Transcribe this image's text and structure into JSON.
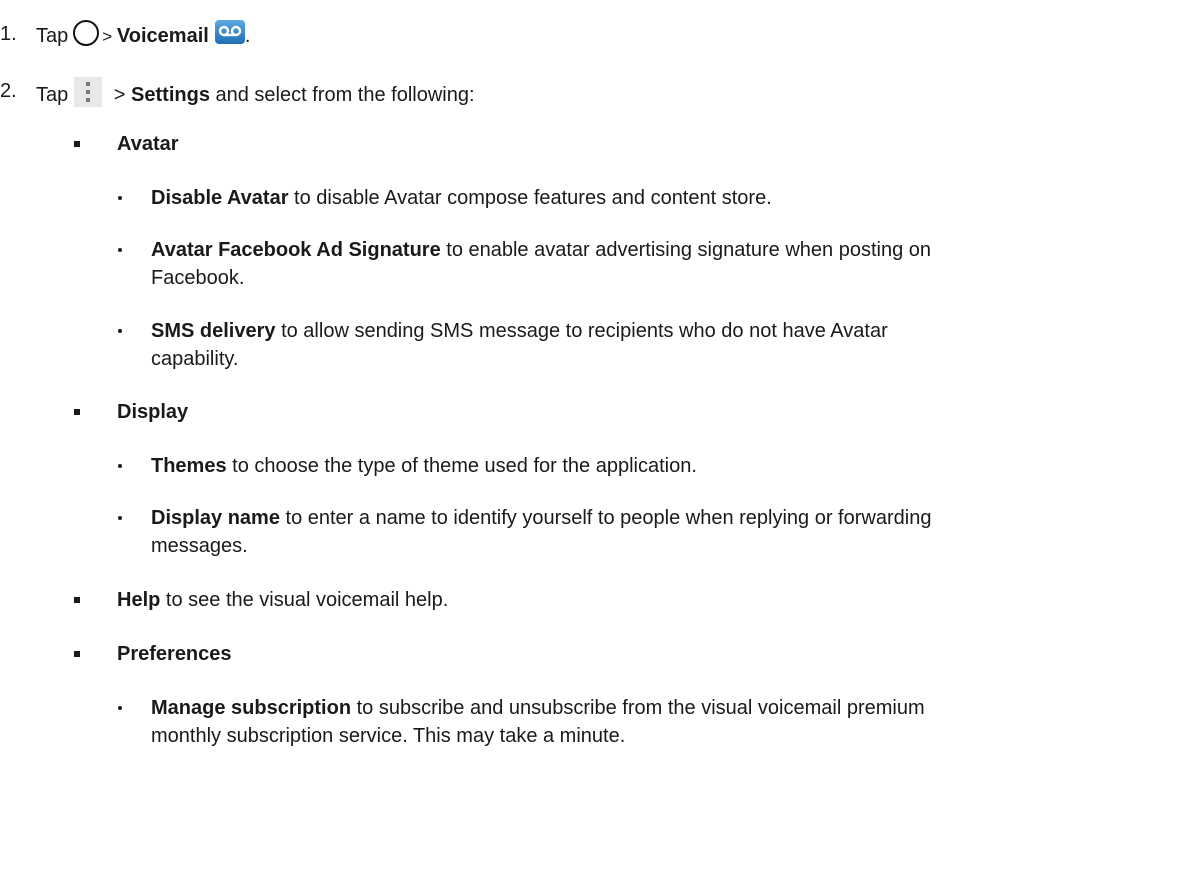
{
  "steps": [
    {
      "number": "1.",
      "pre": "Tap",
      "mid": "> ",
      "bold": "Voicemail",
      "post": "."
    },
    {
      "number": "2.",
      "pre": "Tap",
      "mid": " > ",
      "bold": "Settings",
      "post": " and select from the following:"
    }
  ],
  "sections": {
    "avatar": {
      "heading": "Avatar",
      "items": [
        {
          "bold": "Disable Avatar",
          "text": " to disable Avatar compose features and content store."
        },
        {
          "bold": "Avatar Facebook Ad Signature",
          "text": " to enable avatar advertising signature when posting on",
          "text2": "Facebook."
        },
        {
          "bold": "SMS delivery",
          "text": " to allow sending SMS message to recipients who do not have Avatar",
          "text2": "capability."
        }
      ]
    },
    "display": {
      "heading": "Display",
      "items": [
        {
          "bold": "Themes",
          "text": " to choose the type of theme used for the application."
        },
        {
          "bold": "Display name",
          "text": " to enter a name to identify yourself to people when replying or forwarding",
          "text2": "messages."
        }
      ]
    },
    "help": {
      "bold": "Help",
      "text": " to see the visual voicemail help."
    },
    "preferences": {
      "heading": "Preferences",
      "items": [
        {
          "bold": "Manage subscription",
          "text": " to subscribe and unsubscribe from the visual voicemail premium",
          "text2": "monthly subscription service. This may take a minute."
        }
      ]
    }
  },
  "icons": {
    "home": "home-circle-icon",
    "voicemail": "voicemail-icon",
    "menu": "overflow-menu-icon",
    "voicemail_color": "#2a7bc0"
  }
}
